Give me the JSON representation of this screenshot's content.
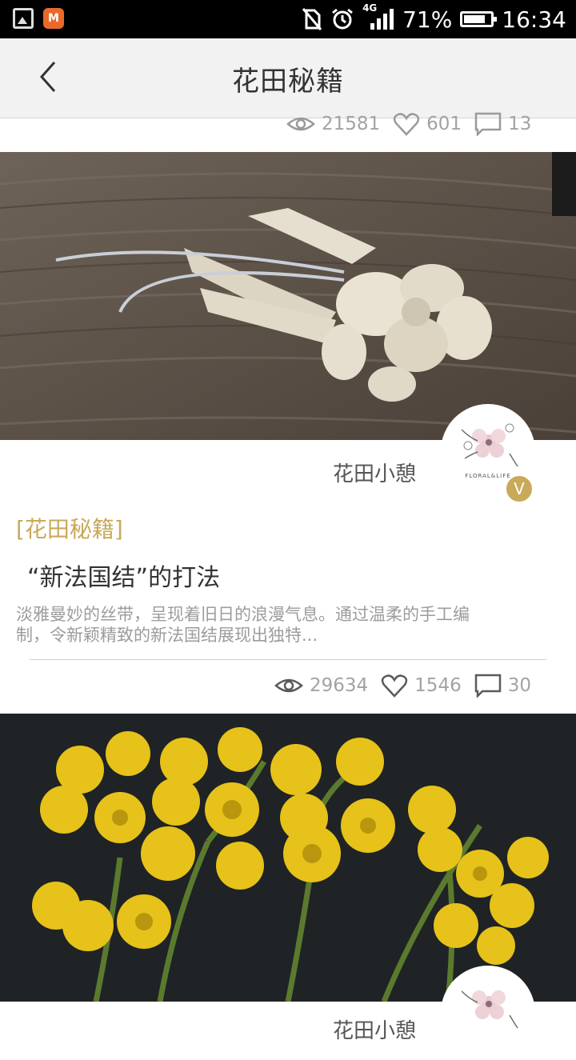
{
  "status_bar": {
    "network": "4G",
    "battery_percent_label": "71%",
    "battery_level": 0.71,
    "time": "16:34"
  },
  "header": {
    "title": "花田秘籍"
  },
  "articles": [
    {
      "views": "21581",
      "likes": "601",
      "comments": "13"
    },
    {
      "author": "花田小憩",
      "avatar_caption": "FLORAL&LIFE",
      "verified_badge": "V",
      "category": "[花田秘籍]",
      "title": "“新法国结”的打法",
      "excerpt": "淡雅曼妙的丝带，呈现着旧日的浪漫气息。通过温柔的手工编制，令新颖精致的新法国结展现出独特...",
      "views": "29634",
      "likes": "1546",
      "comments": "30"
    },
    {
      "author": "花田小憩"
    }
  ],
  "colors": {
    "accent_gold": "#c9a95a",
    "appbar_bg": "#f2f2f2",
    "stat_grey": "#a3a3a3"
  },
  "icons": [
    "back-icon",
    "eye-icon",
    "heart-icon",
    "comment-icon",
    "gallery-icon",
    "app-icon",
    "signal-icon",
    "alarm-icon",
    "battery-icon"
  ]
}
